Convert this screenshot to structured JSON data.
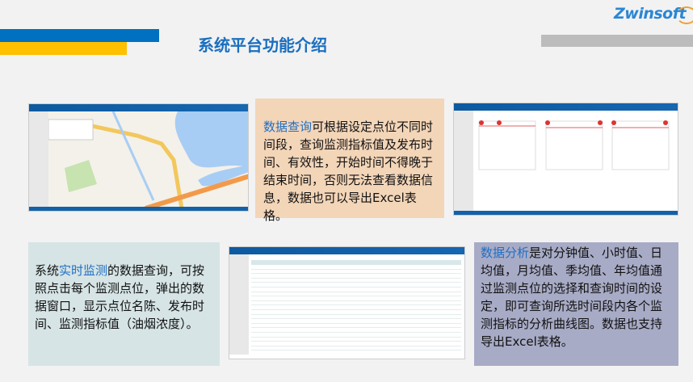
{
  "header": {
    "title": "系统平台功能介绍",
    "logo": "Zwinsoft"
  },
  "colors": {
    "accent_blue": "#0070c0",
    "accent_yellow": "#ffc000",
    "highlight": "#1f6fc5"
  },
  "panels": {
    "query": {
      "highlight": "数据查询",
      "text": "可根据设定点位不同时间段，查询监测指标值及发布时间、有效性，开始时间不得晚于结束时间，否则无法查看数据信息，数据也可以导出Excel表格。"
    },
    "realtime": {
      "prefix": "系统",
      "highlight": "实时监测",
      "text": "的数据查询，可按照点击每个监测点位，弹出的数据窗口，显示点位名陈、发布时间、监测指标值（油烟浓度）。"
    },
    "analysis": {
      "highlight": "数据分析",
      "text": "是对分钟值、小时值、日均值，月均值、季均值、年均值通过监测点位的选择和查询时间的设定，即可查询所选时间段内各个监测指标的分析曲线图。数据也支持导出Excel表格。"
    }
  }
}
